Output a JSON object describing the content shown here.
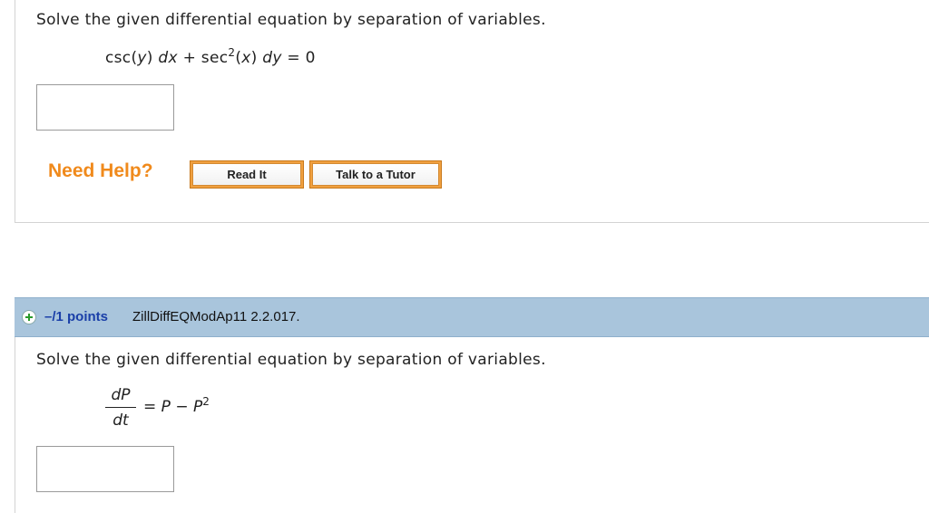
{
  "question1": {
    "prompt": "Solve the given differential equation by separation of variables.",
    "equation": {
      "part1": "csc(",
      "var_y": "y",
      "part2": ") ",
      "dx": "dx",
      "part3": " + sec",
      "exp": "2",
      "part4": "(",
      "var_x": "x",
      "part5": ") ",
      "dy": "dy",
      "part6": " = 0"
    },
    "answer_value": "",
    "help": {
      "need_help_label": "Need Help?",
      "read_it_label": "Read It",
      "tutor_label": "Talk to a Tutor"
    }
  },
  "question2": {
    "points_label": "–/1 points",
    "question_id": "ZillDiffEQModAp11 2.2.017.",
    "prompt": "Solve the given differential equation by separation of variables.",
    "equation": {
      "numerator": "dP",
      "denominator": "dt",
      "rhs_eq": "= ",
      "P1": "P",
      "minus": " − ",
      "P2": "P",
      "exp": "2"
    },
    "answer_value": ""
  },
  "colors": {
    "need_help": "#f08a1c",
    "header_bg": "#a9c5dc",
    "points_text": "#1a3fa8"
  }
}
